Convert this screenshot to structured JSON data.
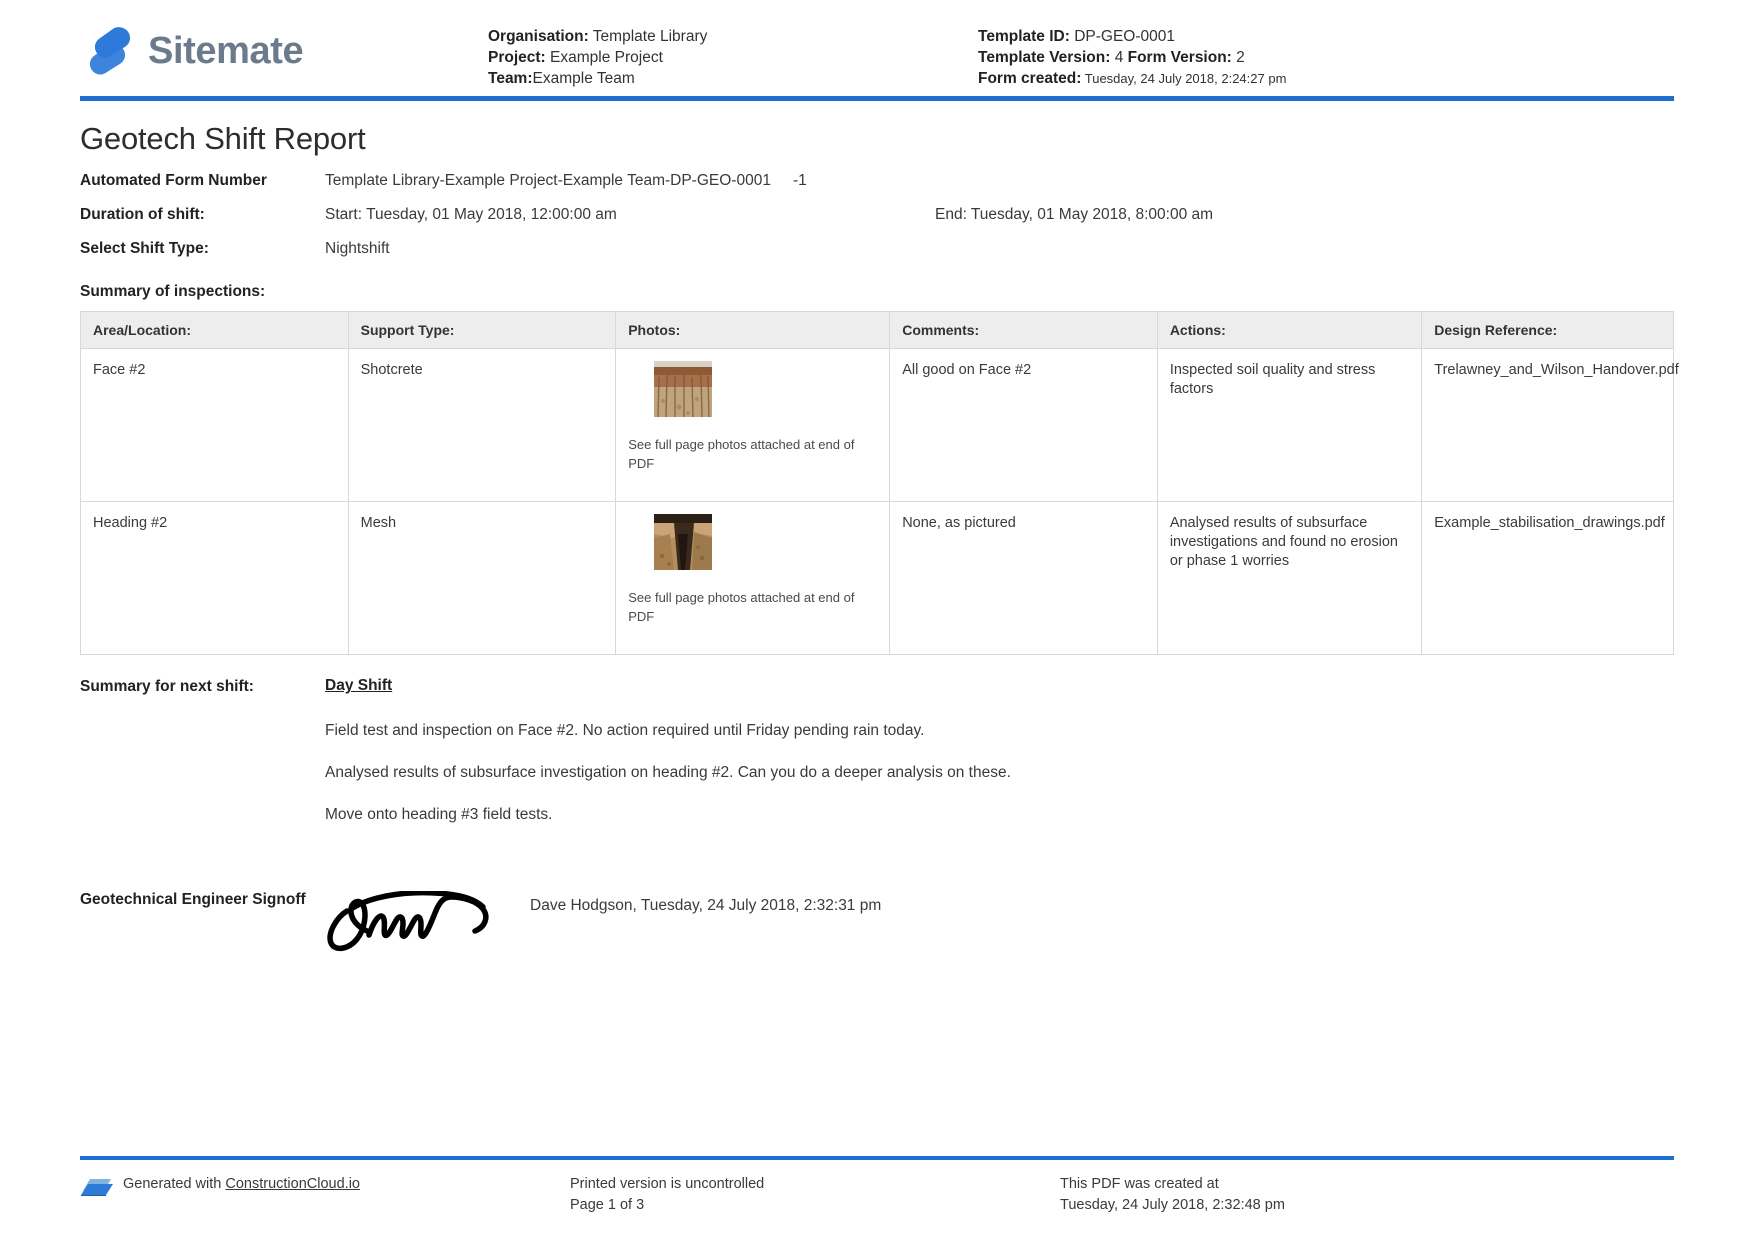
{
  "header": {
    "brand_name": "Sitemate",
    "brand_icon": "sitemate-logo-icon",
    "accent_color": "#1f6fd0",
    "meta_left": [
      {
        "label": "Organisation:",
        "value": "Template Library"
      },
      {
        "label": "Project:",
        "value": "Example Project"
      },
      {
        "label": "Team:",
        "value": "Example Team"
      }
    ],
    "meta_right": {
      "template_id_label": "Template ID:",
      "template_id_value": "DP-GEO-0001",
      "template_version_label": "Template Version:",
      "template_version_value": "4",
      "form_version_label": "Form Version:",
      "form_version_value": "2",
      "form_created_label": "Form created:",
      "form_created_value": "Tuesday, 24 July 2018, 2:24:27 pm"
    }
  },
  "document": {
    "title": "Geotech Shift Report",
    "fields": {
      "automated_form_number_label": "Automated Form Number",
      "automated_form_number_value": "Template Library-Example Project-Example Team-DP-GEO-0001",
      "automated_form_number_suffix": "-1",
      "duration_label": "Duration of shift:",
      "duration_start": "Start: Tuesday, 01 May 2018, 12:00:00 am",
      "duration_end": "End: Tuesday, 01 May 2018, 8:00:00 am",
      "shift_type_label": "Select Shift Type:",
      "shift_type_value": "Nightshift"
    },
    "summary_of_inspections_label": "Summary of inspections:",
    "table": {
      "columns": [
        "Area/Location:",
        "Support Type:",
        "Photos:",
        "Comments:",
        "Actions:",
        "Design Reference:"
      ],
      "rows": [
        {
          "area": "Face #2",
          "support": "Shotcrete",
          "photo_note": "See full page photos attached at end of PDF",
          "comments": "All good on Face #2",
          "actions": "Inspected soil quality and stress factors",
          "design": "Trelawney_and_Wilson_Handover.pdf"
        },
        {
          "area": "Heading #2",
          "support": "Mesh",
          "photo_note": "See full page photos attached at end of PDF",
          "comments": "None, as pictured",
          "actions": "Analysed results of subsurface investigations and found no erosion or phase 1 worries",
          "design": "Example_stabilisation_drawings.pdf"
        }
      ]
    },
    "next_shift": {
      "label": "Summary for next shift:",
      "heading": "Day Shift",
      "paragraphs": [
        "Field test and inspection on Face #2. No action required until Friday pending rain today.",
        "Analysed results of subsurface investigation on heading #2. Can you do a deeper analysis on these.",
        "Move onto heading #3 field tests."
      ]
    },
    "signoff": {
      "label": "Geotechnical Engineer Signoff",
      "signature_alt": "handwritten-signature",
      "meta": "Dave Hodgson, Tuesday, 24 July 2018, 2:32:31 pm"
    }
  },
  "footer": {
    "generated_with_prefix": "Generated with ",
    "generated_with_link": "ConstructionCloud.io",
    "printed_notice": "Printed version is uncontrolled",
    "page_number": "Page 1 of 3",
    "pdf_created_label": "This PDF was created at",
    "pdf_created_value": "Tuesday, 24 July 2018, 2:32:48 pm",
    "cloud_icon": "cloud-icon"
  }
}
